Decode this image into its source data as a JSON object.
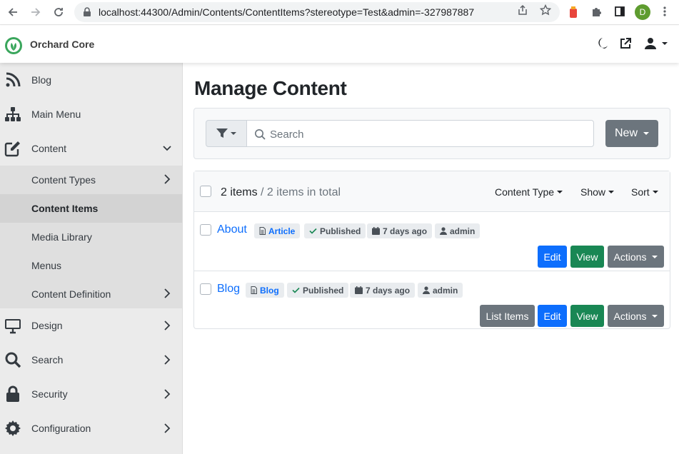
{
  "browser": {
    "url": "localhost:44300/Admin/Contents/ContentItems?stereotype=Test&admin=-327987887",
    "profile_initial": "D"
  },
  "header": {
    "brand": "Orchard Core",
    "icons": [
      "moon-icon",
      "external-link-icon",
      "user-icon"
    ]
  },
  "sidebar": {
    "items": [
      {
        "label": "Blog",
        "icon": "rss-icon"
      },
      {
        "label": "Main Menu",
        "icon": "sitemap-icon"
      },
      {
        "label": "Content",
        "icon": "edit-icon"
      },
      {
        "label": "Design",
        "icon": "desktop-icon"
      },
      {
        "label": "Search",
        "icon": "search-icon"
      },
      {
        "label": "Security",
        "icon": "lock-icon"
      },
      {
        "label": "Configuration",
        "icon": "cog-icon"
      }
    ],
    "content_sub": [
      {
        "label": "Content Types"
      },
      {
        "label": "Content Items",
        "active": true
      },
      {
        "label": "Media Library"
      },
      {
        "label": "Menus"
      },
      {
        "label": "Content Definition"
      }
    ]
  },
  "main": {
    "title": "Manage Content",
    "search_placeholder": "Search",
    "new_label": "New",
    "count": "2 items",
    "count_total": " / 2 items in total",
    "filters": {
      "content_type": "Content Type",
      "show": "Show",
      "sort": "Sort"
    },
    "items": [
      {
        "title": "About",
        "type": "Article",
        "status": "Published",
        "date": "7 days ago",
        "owner": "admin",
        "buttons": {
          "edit": "Edit",
          "view": "View",
          "actions": "Actions"
        }
      },
      {
        "title": "Blog",
        "type": "Blog",
        "status": "Published",
        "date": "7 days ago",
        "owner": "admin",
        "buttons": {
          "list": "List Items",
          "edit": "Edit",
          "view": "View",
          "actions": "Actions"
        }
      }
    ]
  },
  "colors": {
    "primary": "#0d6efd",
    "success": "#198754",
    "secondary": "#6c757d",
    "sidebar": "#ebebeb"
  }
}
